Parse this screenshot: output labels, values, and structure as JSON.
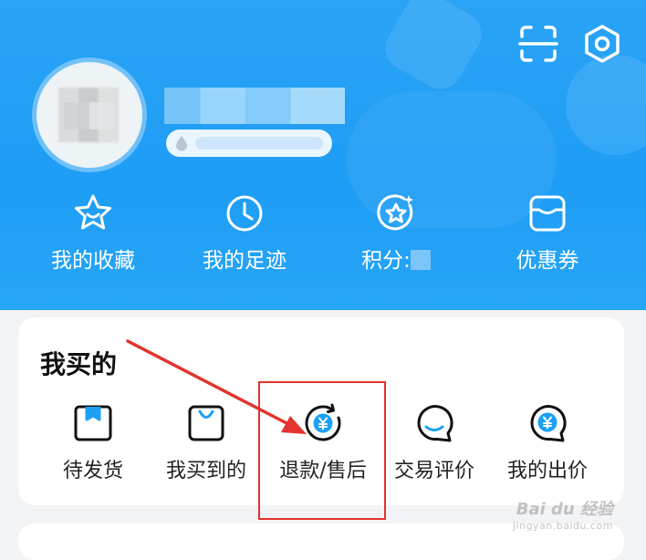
{
  "header": {
    "quick_links": [
      {
        "label": "我的收藏",
        "icon": "star-icon"
      },
      {
        "label": "我的足迹",
        "icon": "clock-icon"
      },
      {
        "label": "积分:",
        "icon": "points-star-icon"
      },
      {
        "label": "优惠券",
        "icon": "coupon-icon"
      }
    ]
  },
  "purchases": {
    "title": "我买的",
    "items": [
      {
        "label": "待发货",
        "icon": "package-icon"
      },
      {
        "label": "我买到的",
        "icon": "shopping-bag-icon"
      },
      {
        "label": "退款/售后",
        "icon": "refund-yen-icon"
      },
      {
        "label": "交易评价",
        "icon": "review-bubble-icon"
      },
      {
        "label": "我的出价",
        "icon": "bid-yen-icon"
      }
    ]
  },
  "watermark": {
    "main": "Bai du 经验",
    "sub": "jingyan.baidu.com"
  },
  "colors": {
    "header_blue": "#1e9df5",
    "annotation_red": "#e2332e"
  }
}
